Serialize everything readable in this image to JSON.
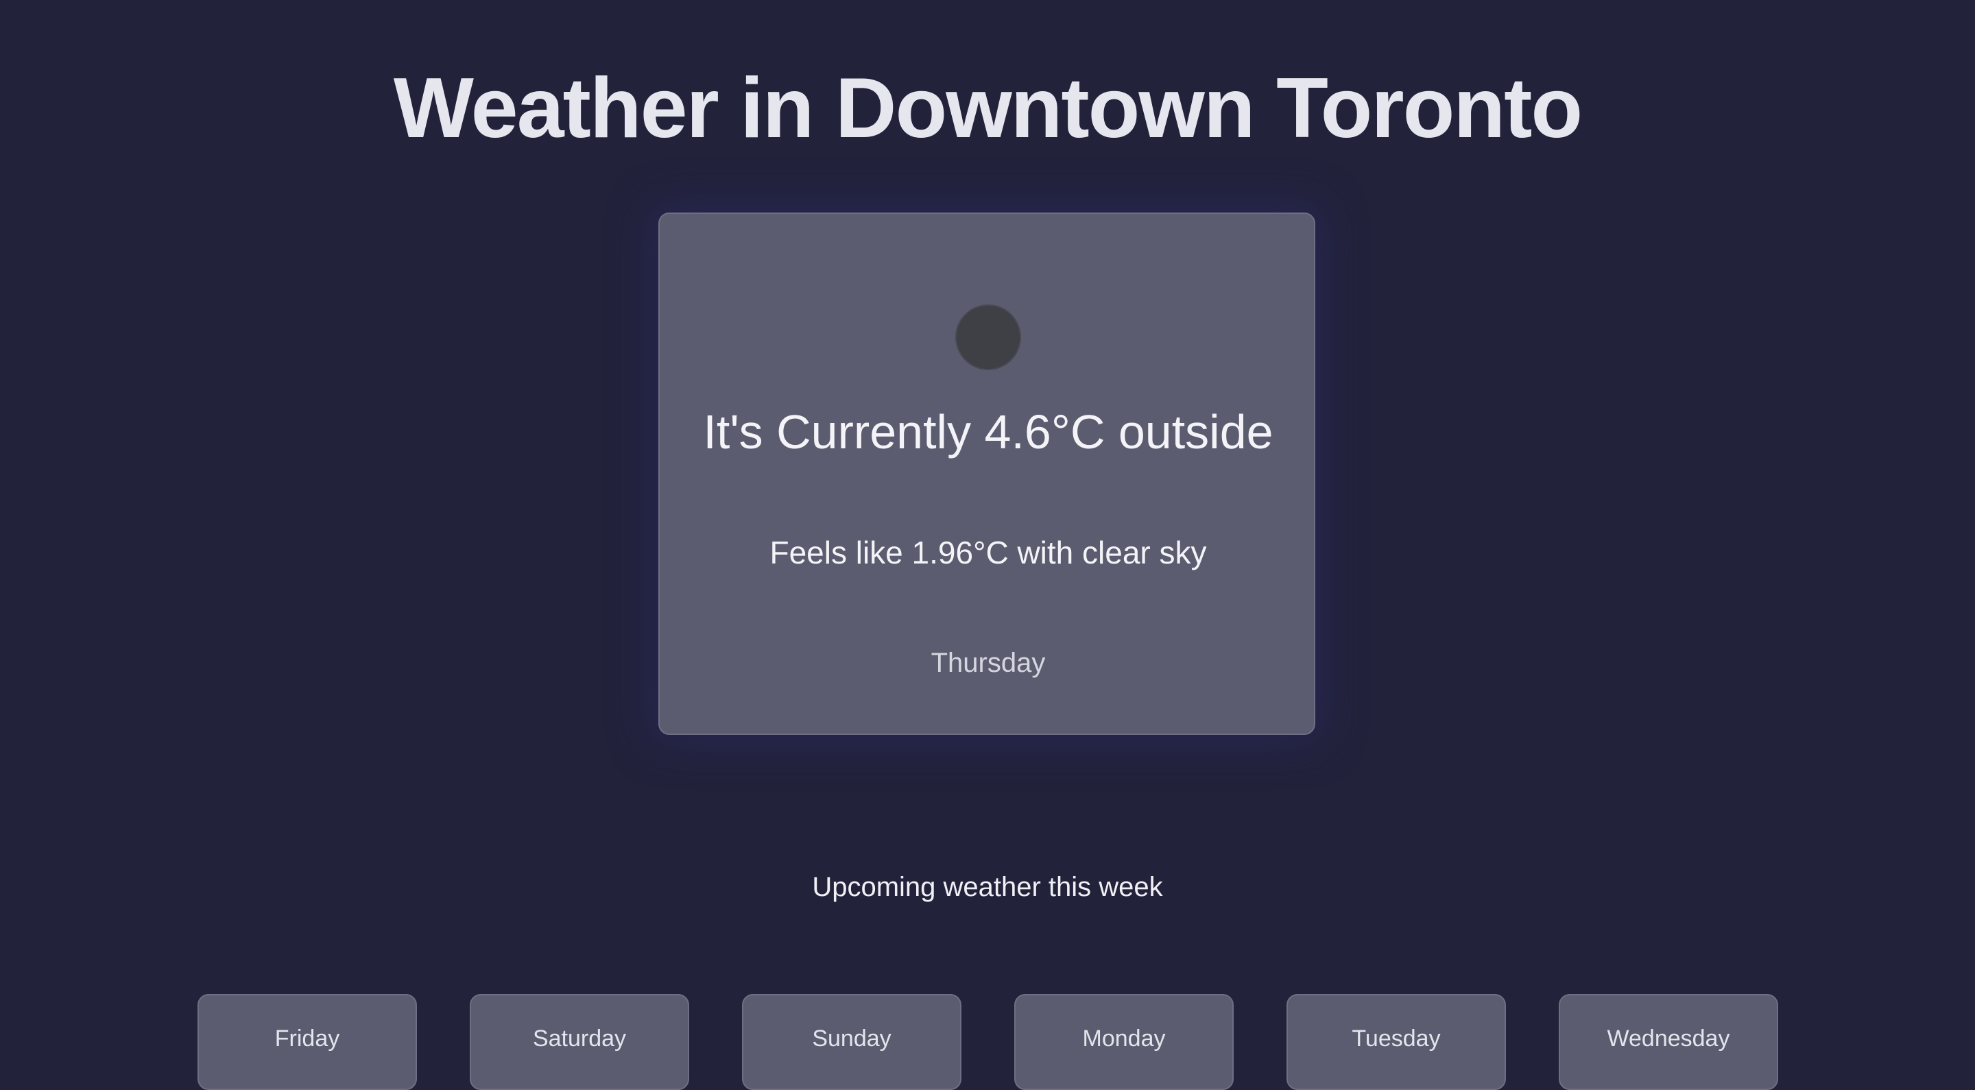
{
  "page": {
    "title": "Weather in Downtown Toronto"
  },
  "current": {
    "icon": "weather-condition-icon",
    "temperature_text": "It's Currently 4.6°C outside",
    "feels_like_text": "Feels like 1.96°C with clear sky",
    "day": "Thursday"
  },
  "upcoming": {
    "heading": "Upcoming weather this week",
    "days": [
      {
        "day": "Friday"
      },
      {
        "day": "Saturday"
      },
      {
        "day": "Sunday"
      },
      {
        "day": "Monday"
      },
      {
        "day": "Tuesday"
      },
      {
        "day": "Wednesday"
      }
    ]
  },
  "colors": {
    "background": "#22223b",
    "card": "#5c5c70",
    "text": "#f0f0f5"
  }
}
